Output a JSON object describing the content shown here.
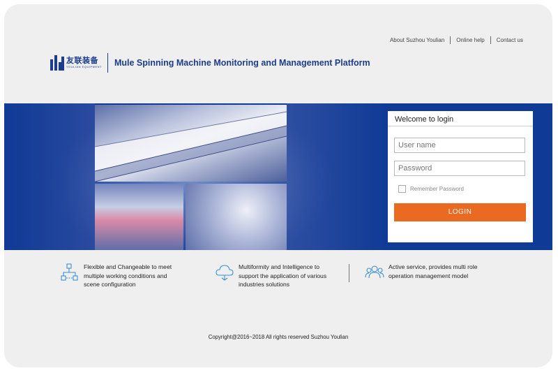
{
  "header": {
    "links": [
      "About Suzhou Youlian",
      "Online help",
      "Contact us"
    ]
  },
  "brand": {
    "logo_cn": "友联装备",
    "logo_en": "YOULIAN EQUIPMENT",
    "title": "Mule Spinning Machine Monitoring and Management Platform",
    "color": "#1c3d8c"
  },
  "login": {
    "title": "Welcome to login",
    "username_placeholder": "User name",
    "password_placeholder": "Password",
    "remember_label": "Remember Password",
    "remember_checked": false,
    "button_label": "LOGIN",
    "button_color": "#ea6a21"
  },
  "banner": {
    "background_color": "#0f3a96"
  },
  "features": [
    {
      "icon": "network-nodes-icon",
      "lines": [
        "Flexible and Changeable  to meet",
        "multiple working conditions and",
        "scene configuration"
      ]
    },
    {
      "icon": "cloud-icon",
      "lines": [
        "Multiformity and Intelligence  to",
        "support the application of various",
        "industries solutions"
      ]
    },
    {
      "icon": "users-icon",
      "lines": [
        "Active service, provides multi role",
        "operation management model"
      ]
    }
  ],
  "footer": {
    "copyright": "Copyright@2016~2018  All rights reserved Suzhou Youlian"
  }
}
